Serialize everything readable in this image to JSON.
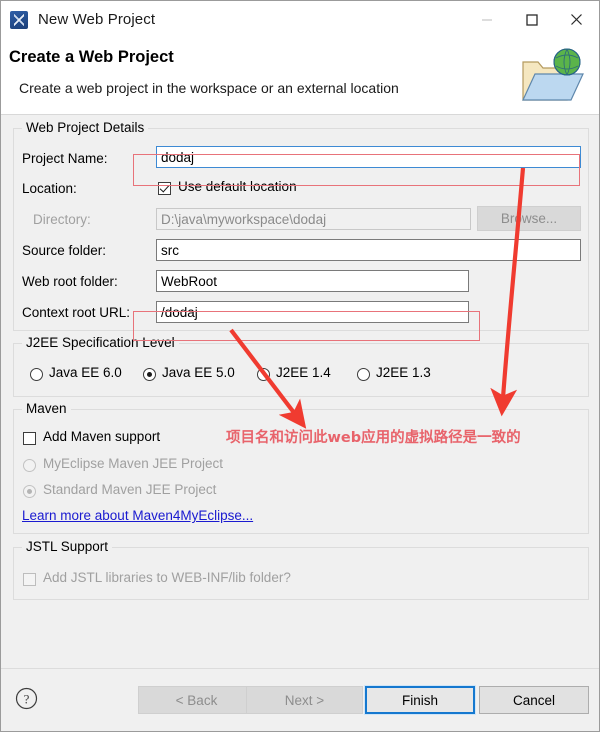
{
  "window": {
    "title": "New Web Project",
    "icon": "myeclipse-icon",
    "controls": {
      "minimize": "minimize-icon",
      "maximize": "maximize-icon",
      "close": "close-icon"
    }
  },
  "header": {
    "title": "Create a Web Project",
    "description": "Create a web project in the workspace or an external location",
    "icon": "web-project-folder-globe-icon"
  },
  "groups": {
    "details": {
      "title": "Web Project Details",
      "fields": {
        "project_name_label": "Project Name:",
        "project_name_value": "dodaj",
        "location_label": "Location:",
        "use_default_location_label": "Use default location",
        "use_default_location_checked": true,
        "directory_label": "Directory:",
        "directory_value": "D:\\java\\myworkspace\\dodaj",
        "browse_label": "Browse...",
        "source_folder_label": "Source folder:",
        "source_folder_value": "src",
        "web_root_folder_label": "Web root folder:",
        "web_root_folder_value": "WebRoot",
        "context_root_url_label": "Context root URL:",
        "context_root_url_value": "/dodaj"
      }
    },
    "j2ee": {
      "title": "J2EE Specification Level",
      "options": [
        {
          "label": "Java EE 6.0",
          "selected": false
        },
        {
          "label": "Java EE 5.0",
          "selected": true
        },
        {
          "label": "J2EE 1.4",
          "selected": false
        },
        {
          "label": "J2EE 1.3",
          "selected": false
        }
      ]
    },
    "maven": {
      "title": "Maven",
      "add_support_label": "Add Maven support",
      "add_support_checked": false,
      "options": [
        {
          "label": "MyEclipse Maven JEE Project",
          "selected": false,
          "disabled": true
        },
        {
          "label": "Standard Maven JEE Project",
          "selected": true,
          "disabled": true
        }
      ],
      "link_label": "Learn more about Maven4MyEclipse..."
    },
    "jstl": {
      "title": "JSTL Support",
      "add_jstl_label": "Add JSTL libraries to WEB-INF/lib folder?",
      "add_jstl_checked": false,
      "add_jstl_disabled": true
    }
  },
  "footer": {
    "help_icon": "help-question-icon",
    "buttons": {
      "back": "< Back",
      "next": "Next >",
      "finish": "Finish",
      "cancel": "Cancel"
    }
  },
  "annotations": {
    "note_text": "项目名和访问此web应用的虚拟路径是一致的",
    "highlight_color": "#e8737a",
    "arrow_color": "#f03b30"
  }
}
